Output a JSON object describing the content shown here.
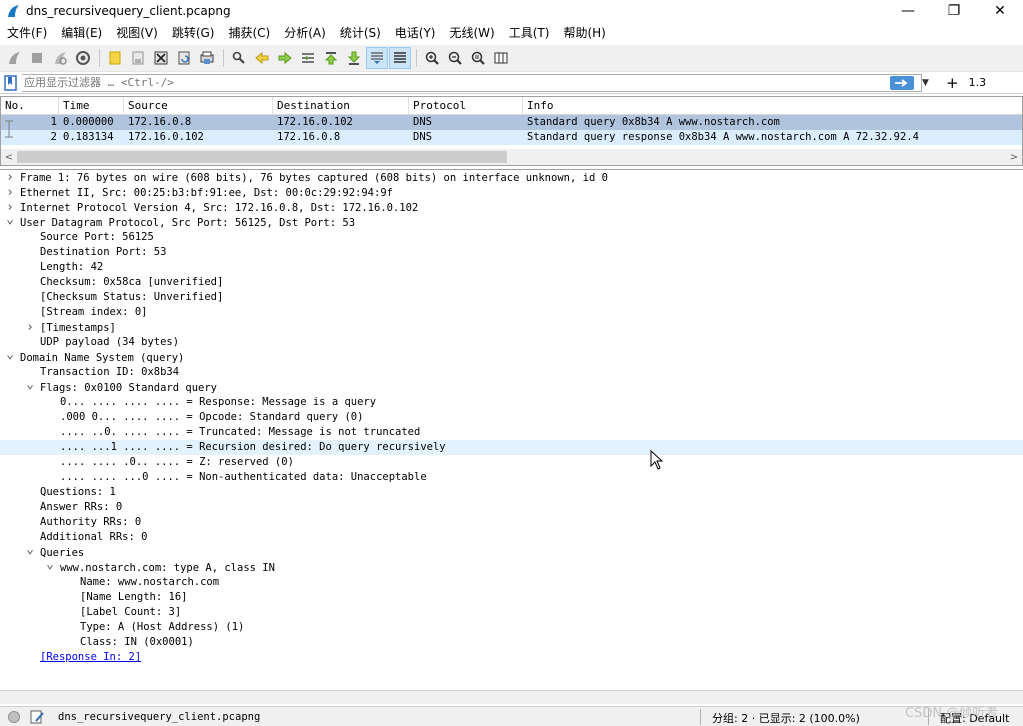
{
  "window": {
    "title": "dns_recursivequery_client.pcapng",
    "minimize": "—",
    "maximize": "❐",
    "close": "✕"
  },
  "menu": [
    "文件(F)",
    "编辑(E)",
    "视图(V)",
    "跳转(G)",
    "捕获(C)",
    "分析(A)",
    "统计(S)",
    "电话(Y)",
    "无线(W)",
    "工具(T)",
    "帮助(H)"
  ],
  "filter": {
    "placeholder": "应用显示过滤器 … <Ctrl-/>",
    "plus": "+",
    "expression_label": "1.3"
  },
  "packet_list": {
    "columns": [
      "No.",
      "Time",
      "Source",
      "Destination",
      "Protocol",
      "Info"
    ],
    "rows": [
      {
        "no": "1",
        "time": "0.000000",
        "source": "172.16.0.8",
        "destination": "172.16.0.102",
        "protocol": "DNS",
        "info": "Standard query 0x8b34 A www.nostarch.com"
      },
      {
        "no": "2",
        "time": "0.183134",
        "source": "172.16.0.102",
        "destination": "172.16.0.8",
        "protocol": "DNS",
        "info": "Standard query response 0x8b34 A www.nostarch.com A 72.32.92.4"
      }
    ]
  },
  "details": [
    {
      "indent": 0,
      "arrow": "right",
      "text": "Frame 1: 76 bytes on wire (608 bits), 76 bytes captured (608 bits) on interface unknown, id 0"
    },
    {
      "indent": 0,
      "arrow": "right",
      "text": "Ethernet II, Src: 00:25:b3:bf:91:ee, Dst: 00:0c:29:92:94:9f"
    },
    {
      "indent": 0,
      "arrow": "right",
      "text": "Internet Protocol Version 4, Src: 172.16.0.8, Dst: 172.16.0.102"
    },
    {
      "indent": 0,
      "arrow": "down",
      "text": "User Datagram Protocol, Src Port: 56125, Dst Port: 53"
    },
    {
      "indent": 1,
      "arrow": "",
      "text": "Source Port: 56125"
    },
    {
      "indent": 1,
      "arrow": "",
      "text": "Destination Port: 53"
    },
    {
      "indent": 1,
      "arrow": "",
      "text": "Length: 42"
    },
    {
      "indent": 1,
      "arrow": "",
      "text": "Checksum: 0x58ca [unverified]"
    },
    {
      "indent": 1,
      "arrow": "",
      "text": "[Checksum Status: Unverified]"
    },
    {
      "indent": 1,
      "arrow": "",
      "text": "[Stream index: 0]"
    },
    {
      "indent": 1,
      "arrow": "right",
      "text": "[Timestamps]"
    },
    {
      "indent": 1,
      "arrow": "",
      "text": "UDP payload (34 bytes)"
    },
    {
      "indent": 0,
      "arrow": "down",
      "text": "Domain Name System (query)"
    },
    {
      "indent": 1,
      "arrow": "",
      "text": "Transaction ID: 0x8b34"
    },
    {
      "indent": 1,
      "arrow": "down",
      "text": "Flags: 0x0100 Standard query"
    },
    {
      "indent": 2,
      "arrow": "",
      "text": "0... .... .... .... = Response: Message is a query"
    },
    {
      "indent": 2,
      "arrow": "",
      "text": ".000 0... .... .... = Opcode: Standard query (0)"
    },
    {
      "indent": 2,
      "arrow": "",
      "text": ".... ..0. .... .... = Truncated: Message is not truncated"
    },
    {
      "indent": 2,
      "arrow": "",
      "text": ".... ...1 .... .... = Recursion desired: Do query recursively",
      "selected": true
    },
    {
      "indent": 2,
      "arrow": "",
      "text": ".... .... .0.. .... = Z: reserved (0)"
    },
    {
      "indent": 2,
      "arrow": "",
      "text": ".... .... ...0 .... = Non-authenticated data: Unacceptable"
    },
    {
      "indent": 1,
      "arrow": "",
      "text": "Questions: 1"
    },
    {
      "indent": 1,
      "arrow": "",
      "text": "Answer RRs: 0"
    },
    {
      "indent": 1,
      "arrow": "",
      "text": "Authority RRs: 0"
    },
    {
      "indent": 1,
      "arrow": "",
      "text": "Additional RRs: 0"
    },
    {
      "indent": 1,
      "arrow": "down",
      "text": "Queries"
    },
    {
      "indent": 2,
      "arrow": "down",
      "text": "www.nostarch.com: type A, class IN"
    },
    {
      "indent": 3,
      "arrow": "",
      "text": "Name: www.nostarch.com"
    },
    {
      "indent": 3,
      "arrow": "",
      "text": "[Name Length: 16]"
    },
    {
      "indent": 3,
      "arrow": "",
      "text": "[Label Count: 3]"
    },
    {
      "indent": 3,
      "arrow": "",
      "text": "Type: A (Host Address) (1)"
    },
    {
      "indent": 3,
      "arrow": "",
      "text": "Class: IN (0x0001)"
    },
    {
      "indent": 1,
      "arrow": "",
      "text": "[Response In: 2]",
      "link": true
    }
  ],
  "status": {
    "file": "dns_recursivequery_client.pcapng",
    "stats": "分组: 2 · 已显示: 2 (100.0%)",
    "profile": "配置: Default"
  },
  "watermark": "CSDN @倾听者"
}
